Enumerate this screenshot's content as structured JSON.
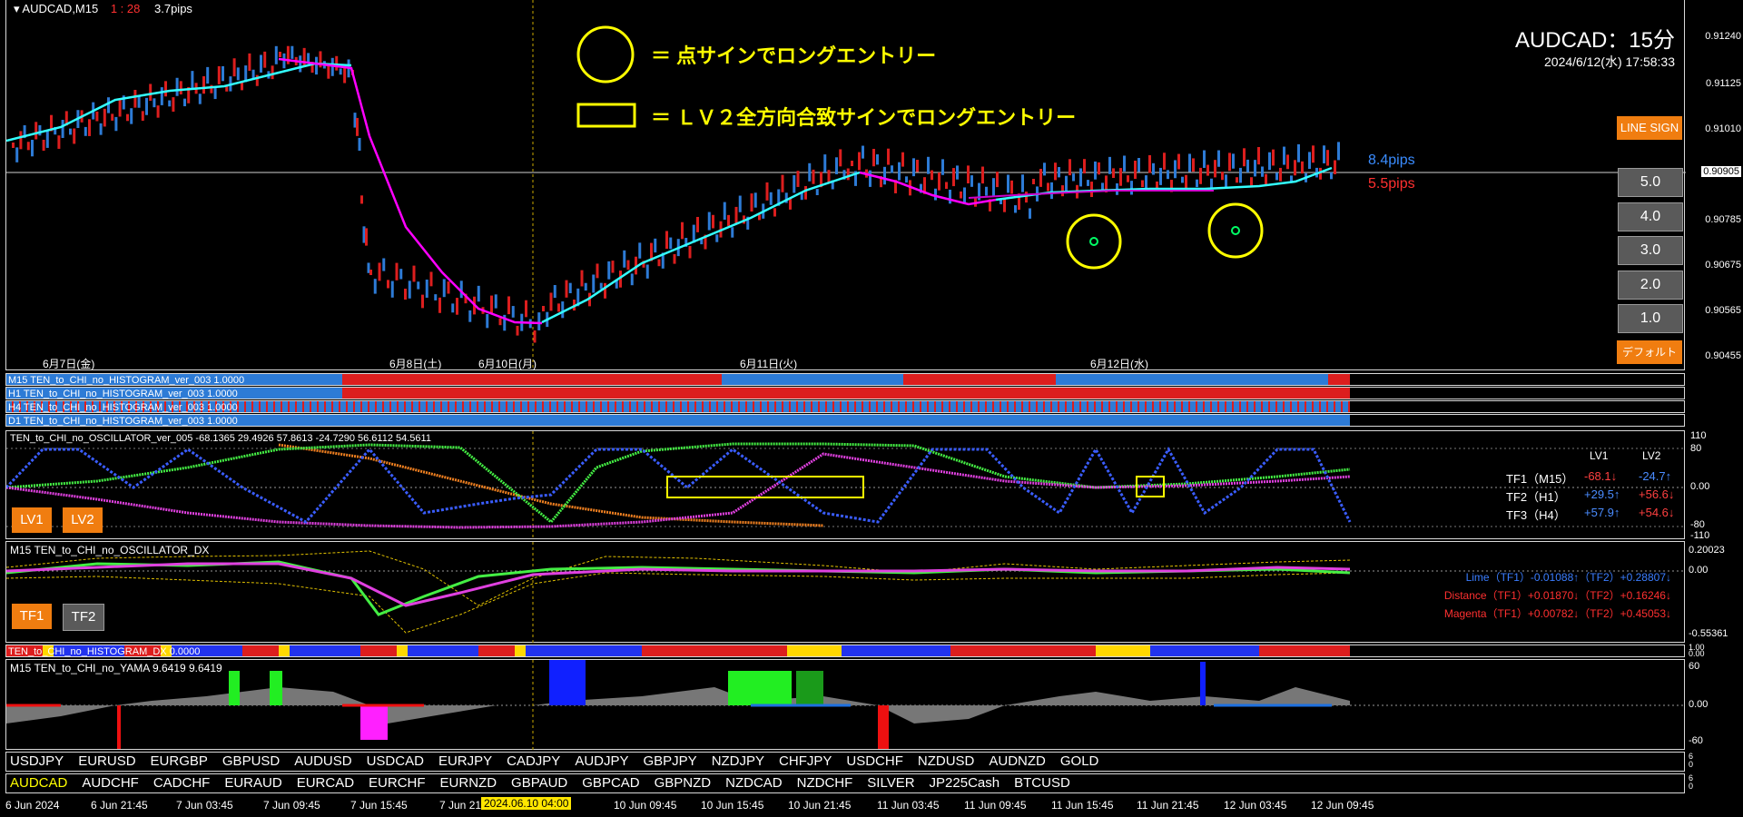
{
  "chart": {
    "title": "AUDCAD,M15",
    "countdown": "1 : 28",
    "spread": "3.7pips",
    "symbol_header": "AUDCAD：15分",
    "datetime": "2024/6/12(水) 17:58:33",
    "current_price": "0.90905",
    "price_axis": [
      "0.91240",
      "0.91125",
      "0.91010",
      "0.90905",
      "0.90785",
      "0.90675",
      "0.90565",
      "0.90455"
    ],
    "profit_label": "8.4pips",
    "loss_label": "5.5pips",
    "day_labels": [
      "6月7日(金)",
      "6月8日(土)",
      "6月10日(月)",
      "6月11日(火)",
      "6月12日(水)"
    ]
  },
  "legend": {
    "circle_text": "＝ 点サインでロングエントリー",
    "rect_text": "＝ ＬＶ２全方向合致サインでロングエントリー"
  },
  "buttons": {
    "line_sign": "LINE SIGN",
    "lots": [
      "5.0",
      "4.0",
      "3.0",
      "2.0",
      "1.0"
    ],
    "default": "デフォルト",
    "lv1": "LV1",
    "lv2": "LV2",
    "tf1": "TF1",
    "tf2": "TF2"
  },
  "histogram_bars": {
    "labels": [
      "M15 TEN_to_CHI_no_HISTOGRAM_ver_003 1.0000",
      "H1 TEN_to_CHI_no_HISTOGRAM_ver_003 1.0000",
      "H4 TEN_to_CHI_no_HISTOGRAM_ver_003 1.0000",
      "D1 TEN_to_CHI_no_HISTOGRAM_ver_003 1.0000"
    ],
    "axis": [
      "0",
      "0",
      "0",
      "0"
    ]
  },
  "oscillator": {
    "title": "TEN_to_CHI_no_OSCILLATOR_ver_005 -68.1365 29.4926 57.8613 -24.7290 56.6112 54.5611",
    "axis": [
      "110",
      "80",
      "0.00",
      "-80",
      "-110"
    ],
    "col_lv1": "LV1",
    "col_lv2": "LV2",
    "rows": [
      {
        "name": "TF1（M15）",
        "lv1": "-68.1↓",
        "lv2": "-24.7↑",
        "c1": "#ff4040",
        "c2": "#4a8cff"
      },
      {
        "name": "TF2（H1）",
        "lv1": "+29.5↑",
        "lv2": "+56.6↓",
        "c1": "#4a8cff",
        "c2": "#ff4040"
      },
      {
        "name": "TF3（H4）",
        "lv1": "+57.9↑",
        "lv2": "+54.6↓",
        "c1": "#4a8cff",
        "c2": "#ff4040"
      }
    ]
  },
  "osc_dx": {
    "title": "M15 TEN_to_CHI_no_OSCILLATOR_DX",
    "axis": [
      "0.20023",
      "0.00",
      "-0.55361"
    ],
    "lines": [
      {
        "text": "Lime（TF1）-0.01088↑（TF2）+0.28807↓",
        "color": "#3a7dff"
      },
      {
        "text": "Distance（TF1）+0.01870↓（TF2）+0.16246↓",
        "color": "#ff3030"
      },
      {
        "text": "Magenta（TF1）+0.00782↓（TF2）+0.45053↓",
        "color": "#ff3030"
      }
    ]
  },
  "hist_dx": {
    "title": "TEN_to_CHI_no_HISTOGRAM_DX 0.0000",
    "axis": [
      "1.00",
      "0.00"
    ]
  },
  "yama": {
    "title": "M15  TEN_to_CHI_no_YAMA  9.6419 9.6419",
    "axis": [
      "60",
      "0.00",
      "-60"
    ]
  },
  "symbols_row1": [
    "USDJPY",
    "EURUSD",
    "EURGBP",
    "GBPUSD",
    "AUDUSD",
    "USDCAD",
    "EURJPY",
    "CADJPY",
    "AUDJPY",
    "GBPJPY",
    "NZDJPY",
    "CHFJPY",
    "USDCHF",
    "NZDUSD",
    "AUDNZD",
    "GOLD"
  ],
  "symbols_row2": [
    "AUDCAD",
    "AUDCHF",
    "CADCHF",
    "EURAUD",
    "EURCAD",
    "EURCHF",
    "EURNZD",
    "GBPAUD",
    "GBPCAD",
    "GBPNZD",
    "NZDCAD",
    "NZDCHF",
    "SILVER",
    "JP225Cash",
    "BTCUSD"
  ],
  "symbols_axis": [
    "6",
    "0"
  ],
  "time_axis": [
    "6 Jun 2024",
    "6 Jun 21:45",
    "7 Jun 03:45",
    "7 Jun 09:45",
    "7 Jun 15:45",
    "7 Jun 21:45",
    "10 Jun 09:45",
    "10 Jun 15:45",
    "10 Jun 21:45",
    "11 Jun 03:45",
    "11 Jun 09:45",
    "11 Jun 15:45",
    "11 Jun 21:45",
    "12 Jun 03:45",
    "12 Jun 09:45"
  ],
  "time_cursor": "2024.06.10 04:00"
}
